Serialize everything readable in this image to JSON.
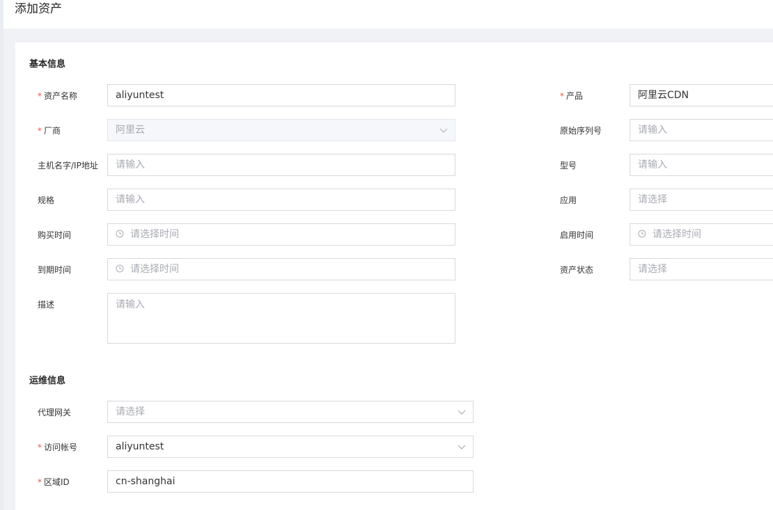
{
  "page": {
    "title": "添加资产"
  },
  "sections": {
    "basic": {
      "title": "基本信息"
    },
    "ops": {
      "title": "运维信息"
    }
  },
  "fields": {
    "asset_name": {
      "label": "资产名称",
      "required": "*",
      "value": "aliyuntest"
    },
    "product": {
      "label": "产品",
      "required": "*",
      "value": "阿里云CDN"
    },
    "vendor": {
      "label": "厂商",
      "required": "*",
      "value": "阿里云"
    },
    "serial": {
      "label": "原始序列号",
      "placeholder": "请输入"
    },
    "host": {
      "label": "主机名字/IP地址",
      "placeholder": "请输入"
    },
    "model": {
      "label": "型号",
      "placeholder": "请输入"
    },
    "spec": {
      "label": "规格",
      "placeholder": "请输入"
    },
    "app": {
      "label": "应用",
      "placeholder": "请选择"
    },
    "purchase_time": {
      "label": "购买时间",
      "placeholder": "请选择时间"
    },
    "enable_time": {
      "label": "启用时间",
      "placeholder": "请选择时间"
    },
    "expire_time": {
      "label": "到期时间",
      "placeholder": "请选择时间"
    },
    "asset_status": {
      "label": "资产状态",
      "placeholder": "请选择"
    },
    "description": {
      "label": "描述",
      "placeholder": "请输入"
    },
    "proxy_gateway": {
      "label": "代理网关",
      "placeholder": "请选择"
    },
    "access_account": {
      "label": "访问帐号",
      "required": "*",
      "value": "aliyuntest"
    },
    "region_id": {
      "label": "区域ID",
      "required": "*",
      "value": "cn-shanghai"
    }
  },
  "icons": {
    "chevron": "chevron-down-icon",
    "clock": "clock-icon"
  },
  "colors": {
    "required": "#e8573e",
    "placeholder": "#a8abb2",
    "border": "#d7d9de",
    "background": "#f1f2f5"
  }
}
